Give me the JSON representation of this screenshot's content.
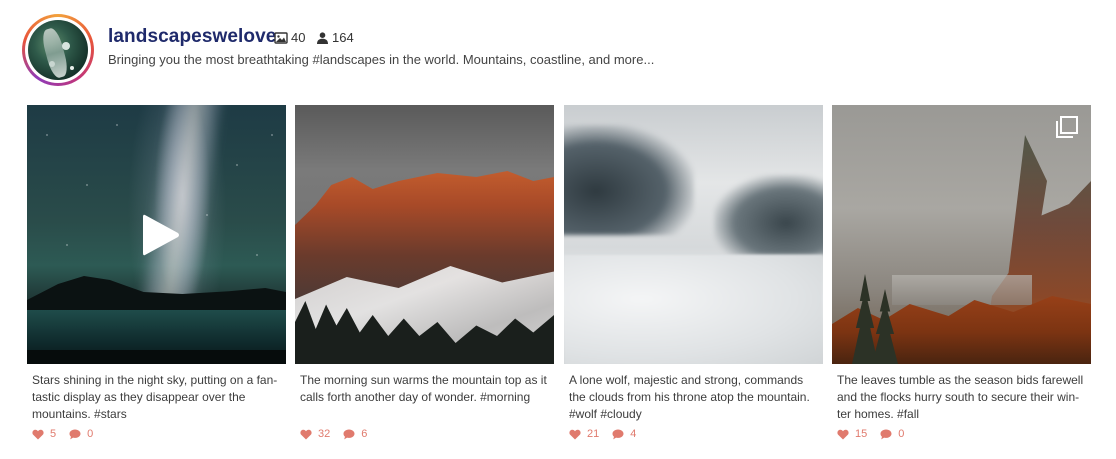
{
  "profile": {
    "username": "landscapeswelove",
    "posts_count": "40",
    "followers_count": "164",
    "bio": "Bringing you the most breathtaking #landscapes in the world. Mountains, coastline, and more..."
  },
  "posts": [
    {
      "caption": "Stars shining in the night sky, putting on a fan-tastic display as they disappear over the mountains. #stars",
      "likes": "5",
      "comments": "0",
      "media_type": "video",
      "icon": "play-icon"
    },
    {
      "caption": "The morning sun warms the mountain top as it calls forth another day of wonder. #morning",
      "likes": "32",
      "comments": "6",
      "media_type": "image"
    },
    {
      "caption": "A lone wolf, majestic and strong, commands the clouds from his throne atop the mountain. #wolf #cloudy",
      "likes": "21",
      "comments": "4",
      "media_type": "image"
    },
    {
      "caption": "The leaves tumble as the season bids farewell and the flocks hurry south to secure their win-ter homes. #fall",
      "likes": "15",
      "comments": "0",
      "media_type": "carousel",
      "icon": "multiple-images-icon"
    }
  ],
  "colors": {
    "username": "#1f2a6b",
    "engagement": "#e07a6d"
  }
}
